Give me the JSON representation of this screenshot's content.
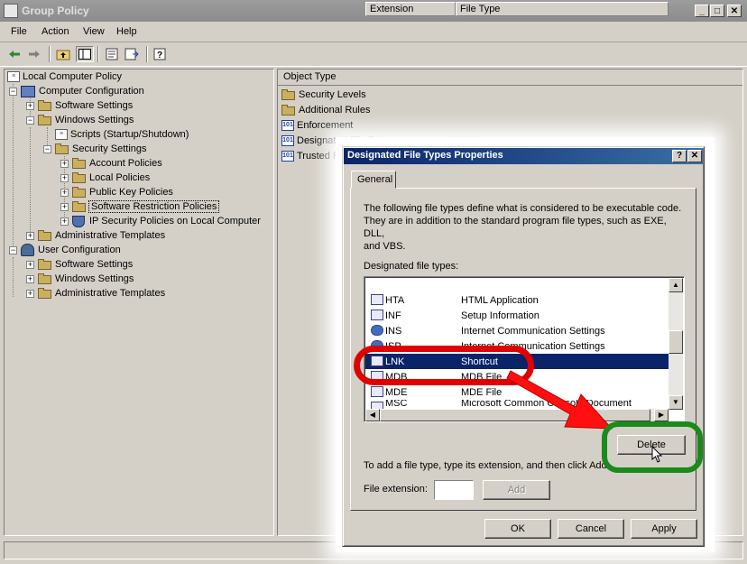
{
  "window": {
    "title": "Group Policy"
  },
  "menu": [
    "File",
    "Action",
    "View",
    "Help"
  ],
  "toolbar": {
    "back_icon": "arrow-left-icon",
    "forward_icon": "arrow-right-icon"
  },
  "tree": {
    "root": "Local Computer Policy",
    "computer_config": "Computer Configuration",
    "software_settings": "Software Settings",
    "windows_settings": "Windows Settings",
    "scripts": "Scripts (Startup/Shutdown)",
    "security_settings": "Security Settings",
    "account_policies": "Account Policies",
    "local_policies": "Local Policies",
    "public_key": "Public Key Policies",
    "software_restriction": "Software Restriction Policies",
    "ip_security": "IP Security Policies on Local Computer",
    "admin_templates": "Administrative Templates",
    "user_config": "User Configuration",
    "user_software_settings": "Software Settings",
    "user_windows_settings": "Windows Settings",
    "user_admin_templates": "Administrative Templates"
  },
  "right_pane": {
    "column_header": "Object Type",
    "items": [
      "Security Levels",
      "Additional Rules",
      "Enforcement",
      "Designated File Types",
      "Trusted Pu"
    ]
  },
  "dialog": {
    "title": "Designated File Types Properties",
    "tab_general": "General",
    "description_line1": "The following file types define what is considered to be executable code.",
    "description_line2": "They are in addition to the standard program file types, such as EXE, DLL,",
    "description_line3": "and VBS.",
    "list_label": "Designated file types:",
    "col_extension": "Extension",
    "col_filetype": "File Type",
    "rows": [
      {
        "ext": "HTA",
        "type": "HTML Application"
      },
      {
        "ext": "INF",
        "type": "Setup Information"
      },
      {
        "ext": "INS",
        "type": "Internet Communication Settings"
      },
      {
        "ext": "ISP",
        "type": "Internet Communication Settings"
      },
      {
        "ext": "LNK",
        "type": "Shortcut"
      },
      {
        "ext": "MDB",
        "type": "MDB File"
      },
      {
        "ext": "MDE",
        "type": "MDE File"
      },
      {
        "ext": "MSC",
        "type": "Microsoft Common Console Document"
      }
    ],
    "selected_ext": "LNK",
    "delete_label": "Delete",
    "add_hint": "To add a file type, type its extension, and then click Add.",
    "file_ext_label": "File extension:",
    "file_ext_value": "",
    "add_label": "Add",
    "ok_label": "OK",
    "cancel_label": "Cancel",
    "apply_label": "Apply",
    "help_label": "?",
    "close_label": "✕"
  },
  "window_buttons": {
    "min": "_",
    "max": "□",
    "close": "✕"
  },
  "colors": {
    "selection": "#0a246a",
    "highlight_red": "#e00000",
    "highlight_green": "#1a8a1a",
    "arrow_red": "#ff1010"
  }
}
